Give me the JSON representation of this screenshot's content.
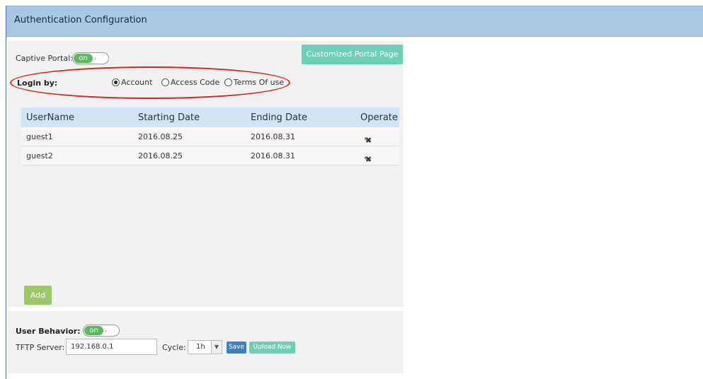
{
  "dialog": {
    "title": "Authentication Configuration",
    "close_symbol": "×"
  },
  "captive_portal": {
    "label": "Captive Portal:",
    "toggle_on": "on",
    "toggle_knob": "."
  },
  "customized_portal_button": "Customized Portal Page",
  "login_by": {
    "label": "Login by:",
    "options": [
      "Account",
      "Access Code",
      "Terms Of use"
    ],
    "selected": "Account"
  },
  "users_table": {
    "headers": [
      "UserName",
      "Starting Date",
      "Ending Date",
      "Operate"
    ],
    "rows": [
      {
        "username": "guest1",
        "start": "2016.08.25",
        "end": "2016.08.31"
      },
      {
        "username": "guest2",
        "start": "2016.08.25",
        "end": "2016.08.31"
      }
    ],
    "edit_icon": "pencil-icon",
    "delete_icon": "delete-icon"
  },
  "add_button": "Add",
  "user_behavior": {
    "label": "User Behavior:",
    "toggle_on": "on",
    "toggle_knob": "."
  },
  "tftp": {
    "label": "TFTP Server:",
    "value": "192.168.0.1"
  },
  "cycle": {
    "label": "Cycle:",
    "value": "1h"
  },
  "save_button": "Save",
  "upload_button": "Upload Now",
  "colors": {
    "header_bg": "#a7c8e2",
    "toggle_on": "#5cb85c",
    "portal_button": "#6ecfb6",
    "add_button": "#9cc86a",
    "save_button": "#3b82c4",
    "highlight_ellipse": "#d32020"
  }
}
